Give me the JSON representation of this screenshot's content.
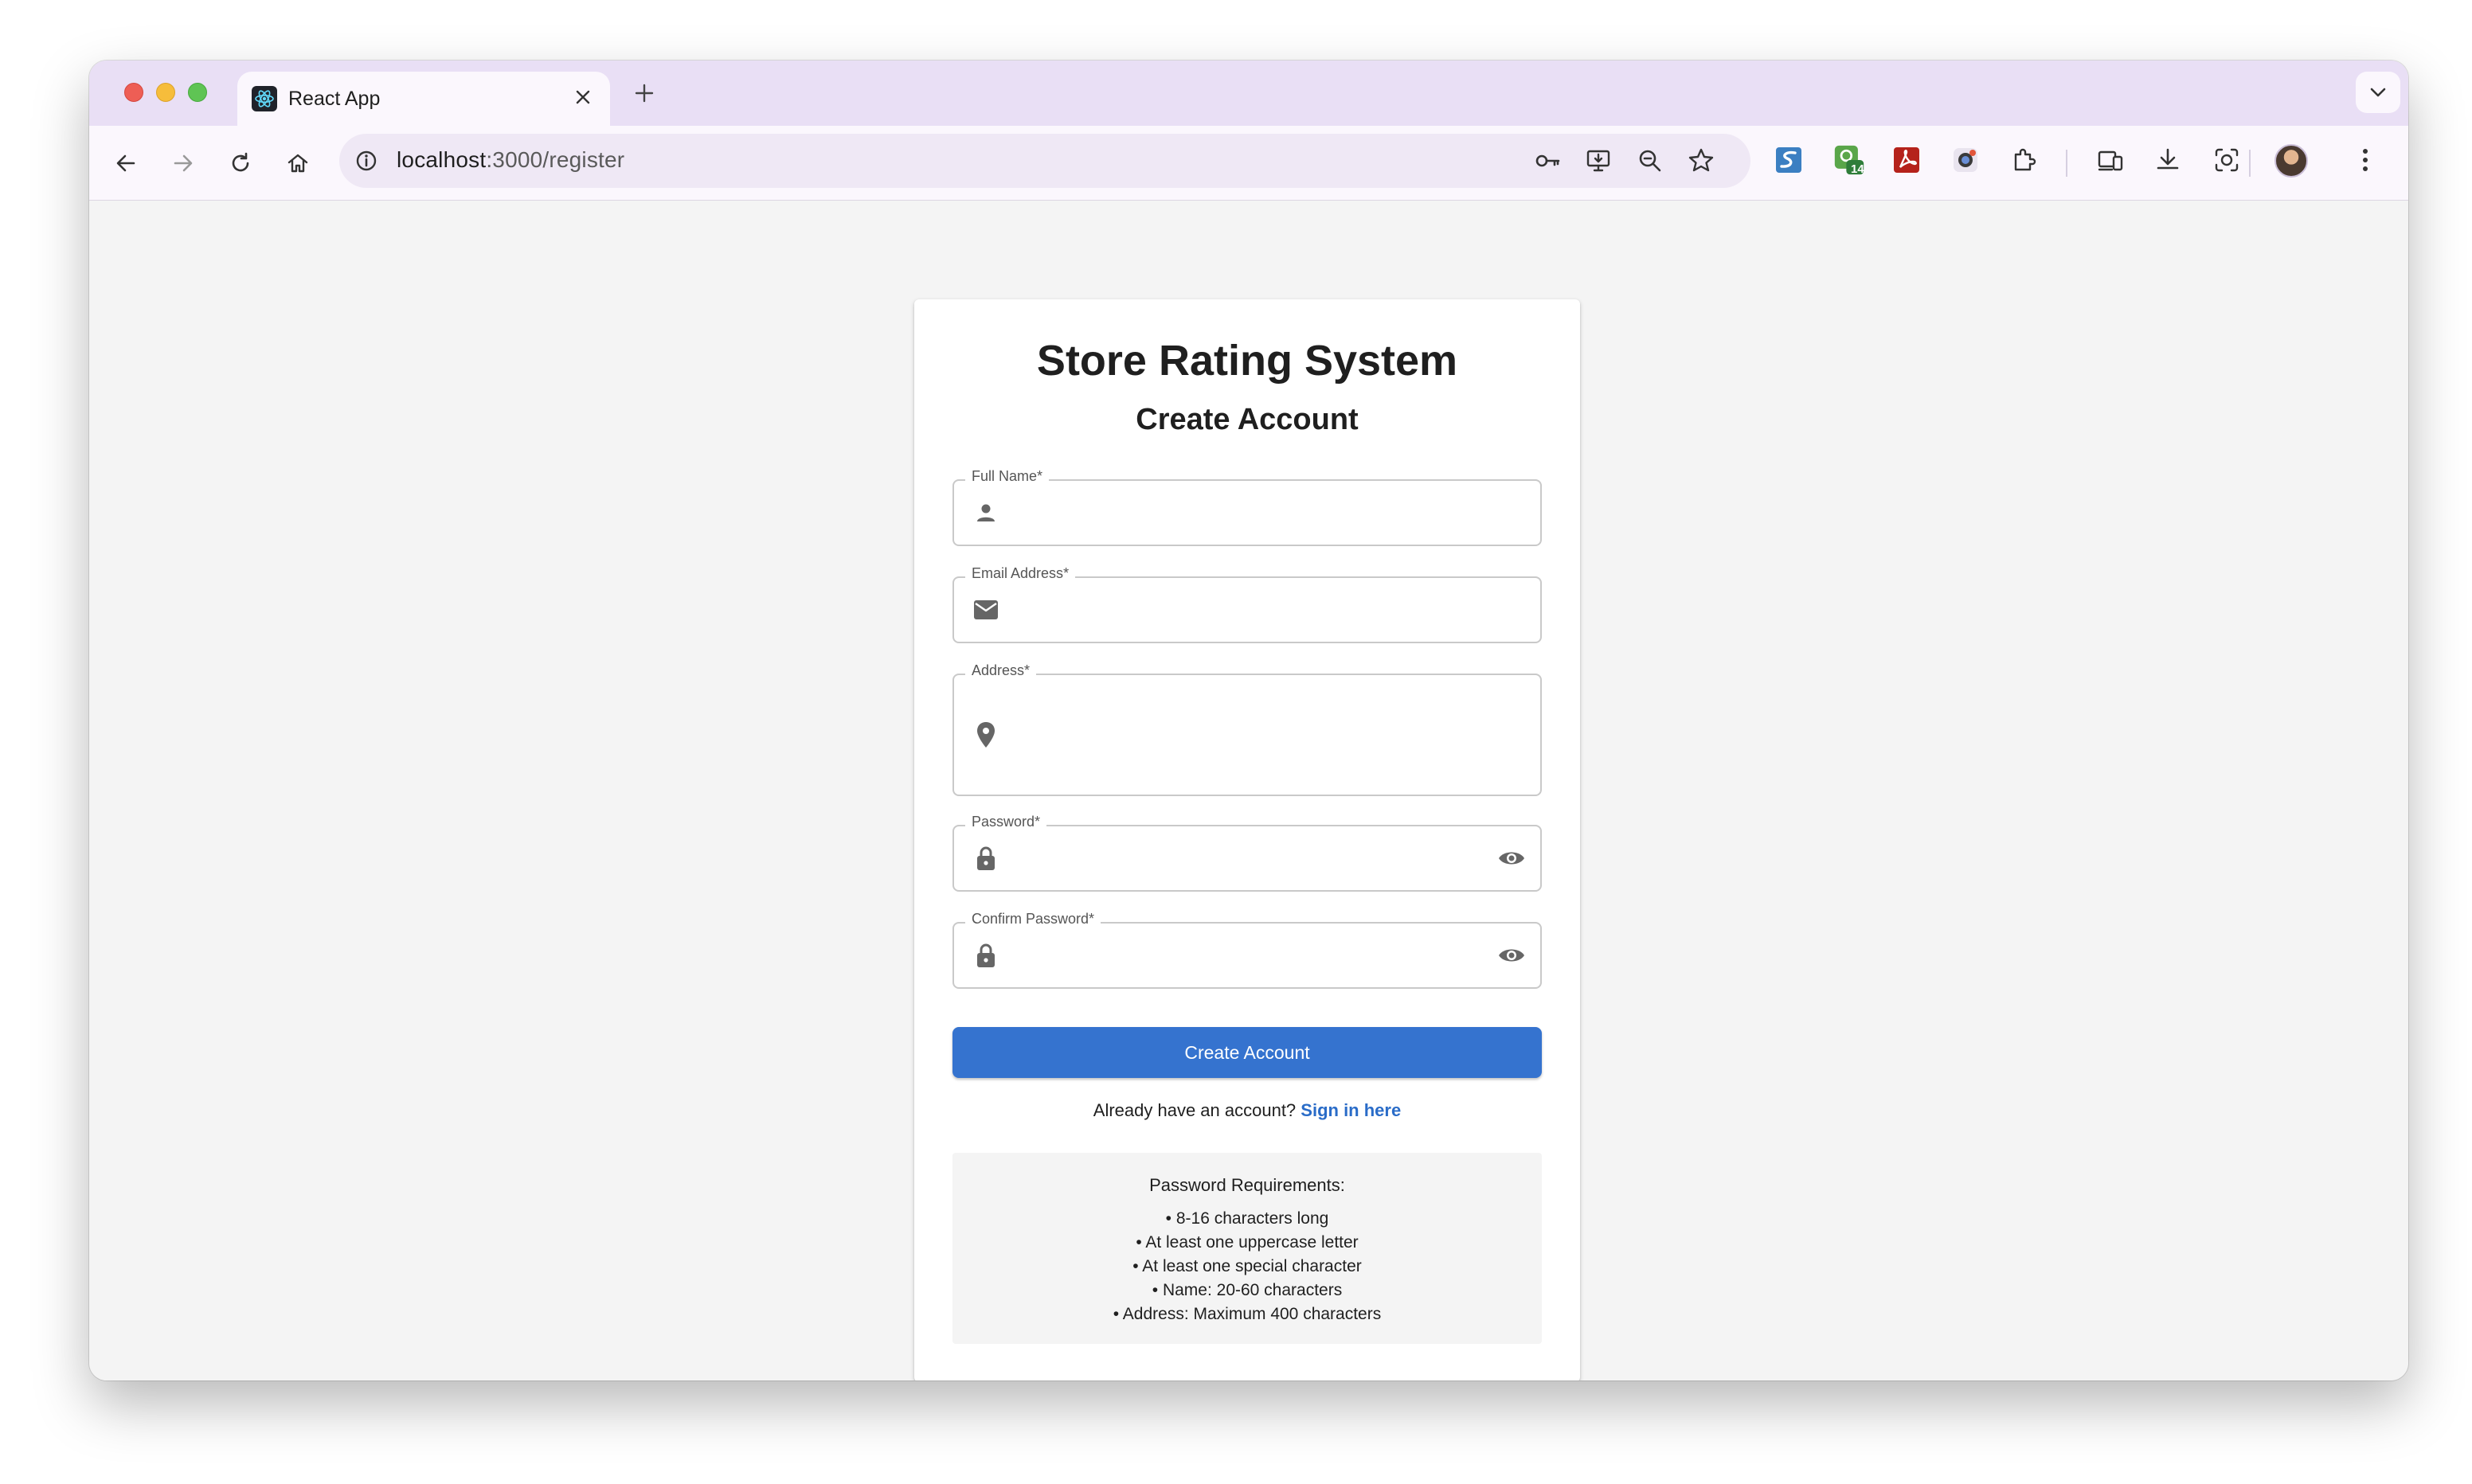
{
  "browser": {
    "tab_title": "React App",
    "url_host": "localhost",
    "url_path": ":3000/register",
    "extension_badge": "14"
  },
  "page": {
    "title": "Store Rating System",
    "subtitle": "Create Account",
    "fields": {
      "full_name": {
        "label": "Full Name",
        "required": "*",
        "value": ""
      },
      "email": {
        "label": "Email Address",
        "required": "*",
        "value": ""
      },
      "address": {
        "label": "Address",
        "required": "*",
        "value": ""
      },
      "password": {
        "label": "Password",
        "required": "*",
        "value": ""
      },
      "confirm_password": {
        "label": "Confirm Password",
        "required": "*",
        "value": ""
      }
    },
    "submit_label": "Create Account",
    "signin_prompt": "Already have an account?",
    "signin_link": "Sign in here",
    "requirements": {
      "title": "Password Requirements:",
      "items": [
        "• 8-16 characters long",
        "• At least one uppercase letter",
        "• At least one special character",
        "• Name: 20-60 characters",
        "• Address: Maximum 400 characters"
      ]
    }
  },
  "colors": {
    "primary": "#3573cf",
    "link": "#2a6cc8",
    "tabstrip": "#e9dff5",
    "page_bg": "#f4f4f4"
  },
  "icons": {
    "full_name": "person-icon",
    "email": "mail-icon",
    "address": "location-pin-icon",
    "password": "lock-icon",
    "visibility": "eye-icon"
  }
}
